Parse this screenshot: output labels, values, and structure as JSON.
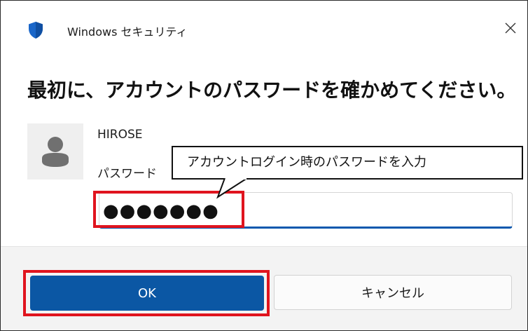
{
  "window": {
    "app_title": "Windows セキュリティ",
    "icon": "shield-icon",
    "close_icon": "close-icon",
    "close_glyph": "✕"
  },
  "prompt": {
    "heading": "最初に、アカウントのパスワードを確かめてください。"
  },
  "account": {
    "avatar_icon": "user-avatar-icon",
    "username": "HIROSE",
    "password_label": "パスワード",
    "password_value": "●●●●●●●"
  },
  "annotation": {
    "callout_text": "アカウントログイン時のパスワードを入力",
    "highlight_color": "#e0141e"
  },
  "buttons": {
    "ok_label": "OK",
    "cancel_label": "キャンセル"
  },
  "colors": {
    "accent": "#0b57a4",
    "shield_blue": "#1a66c9"
  }
}
